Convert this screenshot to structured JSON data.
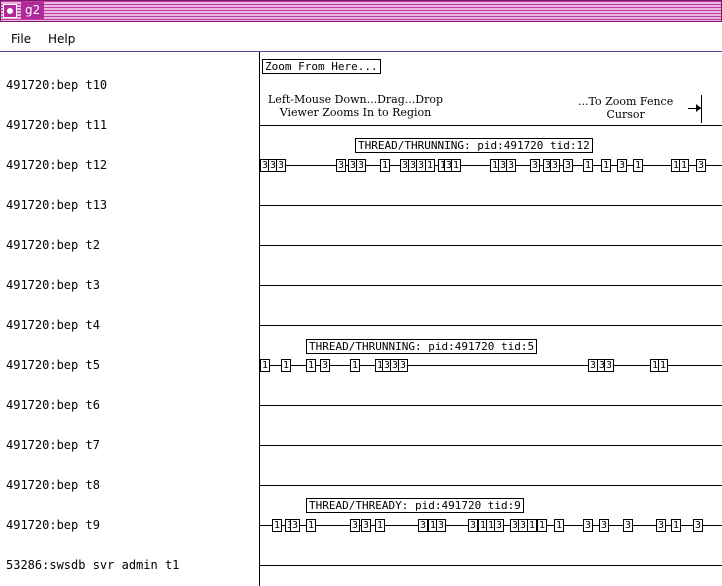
{
  "window": {
    "title": "g2"
  },
  "menu": {
    "file": "File",
    "help": "Help"
  },
  "threads": [
    "491720:bep t10",
    "491720:bep t11",
    "491720:bep t12",
    "491720:bep t13",
    "491720:bep t2",
    "491720:bep t3",
    "491720:bep t4",
    "491720:bep t5",
    "491720:bep t6",
    "491720:bep t7",
    "491720:bep t8",
    "491720:bep t9",
    "53286:swsdb svr admin t1"
  ],
  "zoom": {
    "button_label": "Zoom From Here...",
    "help_left_line1": "Left-Mouse Down...Drag...Drop",
    "help_left_line2": "Viewer Zooms In to Region",
    "help_right_line1": "...To Zoom Fence",
    "help_right_line2": "Cursor"
  },
  "event_labels": {
    "t12": "THREAD/THRUNNING: pid:491720 tid:12",
    "t5": "THREAD/THRUNNING: pid:491720 tid:5",
    "t9": "THREAD/THREADY: pid:491720 tid:9"
  },
  "events": {
    "t12": [
      "3",
      "3",
      "3",
      "3",
      "3",
      "3",
      "1",
      "3",
      "3",
      "3",
      "1",
      "1",
      "3",
      "1",
      "1",
      "3",
      "3",
      "3",
      "3",
      "3",
      "3",
      "1",
      "1",
      "3",
      "1",
      "1",
      "1",
      "3"
    ],
    "t5": [
      "1",
      "1",
      "1",
      "3",
      "1",
      "1",
      "3",
      "3",
      "3",
      "3",
      "3",
      "3",
      "1",
      "1"
    ],
    "t9": [
      "1",
      "3",
      "3",
      "1",
      "3",
      "3",
      "1",
      "3",
      "1",
      "3",
      "3",
      "1",
      "1",
      "3",
      "3",
      "3",
      "1",
      "1",
      "1",
      "3",
      "3",
      "3",
      "3",
      "1",
      "3"
    ]
  }
}
